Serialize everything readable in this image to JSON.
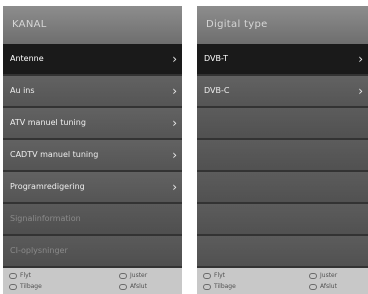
{
  "left_panel": {
    "title": "KANAL",
    "items": [
      {
        "label": "Antenne",
        "arrow": "›",
        "state": "selected"
      },
      {
        "label": "Au ins",
        "arrow": "›",
        "state": "normal"
      },
      {
        "label": "ATV manuel tuning",
        "arrow": "›",
        "state": "normal"
      },
      {
        "label": "CADTV manuel tuning",
        "arrow": "›",
        "state": "normal"
      },
      {
        "label": "Programredigering",
        "arrow": "›",
        "state": "normal"
      },
      {
        "label": "Signalinformation",
        "state": "disabled"
      },
      {
        "label": "CI-oplysninger",
        "state": "disabled"
      }
    ],
    "footer": {
      "move": "Flyt",
      "adjust": "Juster",
      "back": "Tilbage",
      "exit": "Afslut"
    }
  },
  "right_panel": {
    "title": "Digital type",
    "items": [
      {
        "label": "DVB-T",
        "arrow": "›",
        "state": "selected"
      },
      {
        "label": "DVB-C",
        "arrow": "›",
        "state": "normal"
      }
    ],
    "footer": {
      "move": "Flyt",
      "adjust": "Juster",
      "back": "Tilbage",
      "exit": "Afslut"
    }
  },
  "colors": {
    "selected_row": "#1a1a1a",
    "row": "#5b5b5b",
    "title_bar": "#7d7d7d",
    "footer": "#c8c8c8"
  }
}
